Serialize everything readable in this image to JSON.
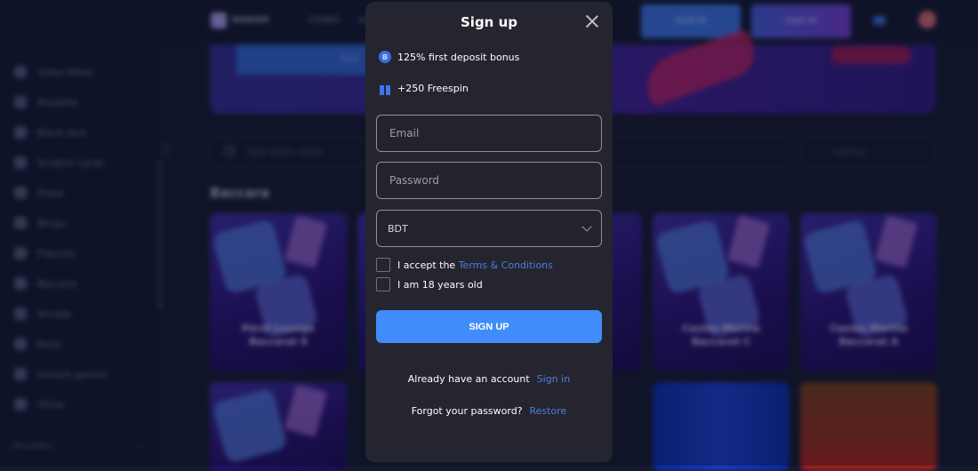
{
  "background": {
    "sidebar_items": [
      "Video Poker",
      "Roulette",
      "Black Jack",
      "Scratch cards",
      "Poker",
      "Bingo",
      "Flipcoin",
      "Baccara",
      "Arcade",
      "Keno",
      "Instant games",
      "Other"
    ],
    "sidebar_footer": "Providers",
    "header": {
      "logo": "BANGER",
      "nav": [
        "CASINO",
        "LIVE"
      ],
      "sign_in": "SIGN IN",
      "sign_up": "SIGN UP"
    },
    "banner_button": "PLAY",
    "search_placeholder": "Type game name",
    "sort_label": "Sorting",
    "section_title": "Baccara",
    "cards": [
      {
        "title": "Pérol Lounge Baccarat 6"
      },
      {
        "title": ""
      },
      {
        "title": ""
      },
      {
        "title": "Casino Marina Baccarat C"
      },
      {
        "title": "Casino Marina Baccarat A"
      }
    ]
  },
  "modal": {
    "title": "Sign up",
    "close_icon": "close-icon",
    "promos": [
      {
        "icon": "bonus-coin-icon",
        "glyph": "B",
        "text": "125% first deposit bonus"
      },
      {
        "icon": "gift-icon",
        "text": "+250 Freespin"
      }
    ],
    "email_placeholder": "Email",
    "password_placeholder": "Password",
    "currency": "BDT",
    "terms_prefix": "I accept the",
    "terms_link": "Terms & Conditions",
    "age_label": "I am 18 years old",
    "submit_label": "SIGN UP",
    "account_prompt": "Already have an account",
    "sign_in_link": "Sign in",
    "forgot_prompt": "Forgot your password?",
    "restore_link": "Restore",
    "colors": {
      "accent": "#3f8cfa",
      "link": "#4a7fe0",
      "panel": "#25252f"
    }
  }
}
